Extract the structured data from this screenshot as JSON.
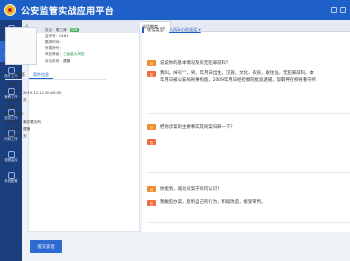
{
  "app": {
    "title": "公安监管实战应用平台"
  },
  "sidebar": {
    "items": [
      {
        "label": "主板首页",
        "icon": "home-icon"
      },
      {
        "label": "综合查询",
        "icon": "search-icon"
      },
      {
        "label": "医疗工作",
        "icon": "medical-icon"
      },
      {
        "label": "管教工作",
        "icon": "shield-icon"
      },
      {
        "label": "巡控工作",
        "icon": "patrol-icon"
      },
      {
        "label": "内勤工作",
        "icon": "file-icon"
      },
      {
        "label": "视频监控",
        "icon": "camera-icon"
      },
      {
        "label": "系统配置",
        "icon": "gear-icon"
      }
    ],
    "active_index": 1
  },
  "tabbar": {
    "home": "⌂",
    "tab_label": "谈话教育",
    "close": "×"
  },
  "person": {
    "rows": [
      {
        "k": "姓名：",
        "v": "周三涛",
        "tag": "待审"
      },
      {
        "k": "监号号：",
        "v": "0161",
        "tag": ""
      },
      {
        "k": "羁押时间：",
        "v": "",
        "tag": ""
      },
      {
        "k": "所属房号：",
        "v": "",
        "tag": ""
      },
      {
        "k": "风险等级：",
        "v": "三级重大风险",
        "tag": ""
      },
      {
        "k": "诉讼阶段：",
        "v": "逮捕",
        "tag": ""
      }
    ]
  },
  "subtabs": {
    "items": [
      "人员标签",
      "案件信息"
    ],
    "active_index": 1
  },
  "details": {
    "rows": [
      {
        "k": "入所原因：",
        "v": ""
      },
      {
        "k": "入所时间：",
        "v": "2019-12-12 00:00:00"
      },
      {
        "k": "关押期限：",
        "v": "无"
      },
      {
        "k": "办案单位：",
        "v": ""
      },
      {
        "k": "法律文书号：",
        "v": ""
      },
      {
        "k": "送押单位：",
        "v": "莱安看办所"
      },
      {
        "k": "诉讼阶段：",
        "v": "逮捕"
      },
      {
        "k": "案由简介：",
        "v": "无"
      }
    ]
  },
  "talk_type": {
    "label": "谈话类型：",
    "value": "入所&小时谈话 ▾"
  },
  "qa": [
    {
      "q": "说说你的基本情况及有无犯罪前科？",
      "a": [
        "我叫，绰号“”，男，年月日出生，汉族，文化，农民，家住址，无犯罪前科。本",
        "年月日被公安局刑事拘留，2009年月日经检察院批准逮捕，现羁押在柳县看守所"
      ]
    },
    {
      "q": "把你涉案的主要事实及同案归罪一下？",
      "a": [
        ""
      ]
    },
    {
      "q": "你能到，城兑对案子有何认识？",
      "a": [
        "我触犯办案，反躬自己的行为，积极改造，接受审判。"
      ]
    }
  ],
  "bottom": {
    "button_label": "提交谈话"
  }
}
